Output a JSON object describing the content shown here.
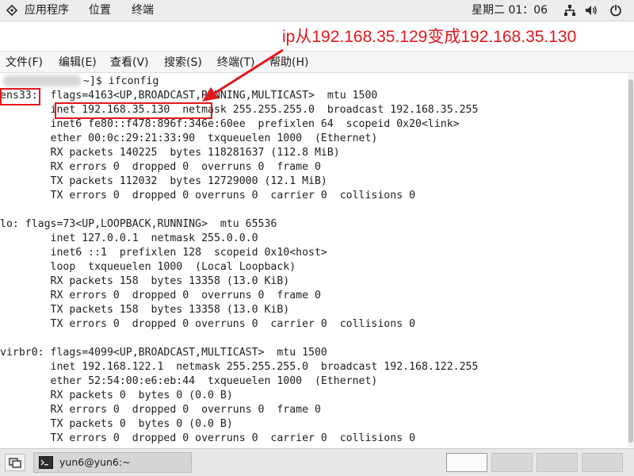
{
  "top_panel": {
    "apps_label": "应用程序",
    "places_label": "位置",
    "terminal_label": "终端",
    "clock": "星期二 01：06",
    "icons": [
      "applications-icon",
      "network-icon",
      "volume-icon",
      "power-icon"
    ]
  },
  "menubar": {
    "file": "文件(F)",
    "edit": "编辑(E)",
    "view": "查看(V)",
    "search": "搜索(S)",
    "terminal": "终端(T)",
    "help": "帮助(H)"
  },
  "annotation": {
    "text": "ip从192.168.35.129变成192.168.35.130",
    "color": "#e3161c"
  },
  "terminal": {
    "prompt_tail": "~]$ ifconfig",
    "lines": [
      "ens33:  flags=4163<UP,BROADCAST,RUNNING,MULTICAST>  mtu 1500",
      "        inet 192.168.35.130  netmask 255.255.255.0  broadcast 192.168.35.255",
      "        inet6 fe80::f478:896f:346e:60ee  prefixlen 64  scopeid 0x20<link>",
      "        ether 00:0c:29:21:33:90  txqueuelen 1000  (Ethernet)",
      "        RX packets 140225  bytes 118281637 (112.8 MiB)",
      "        RX errors 0  dropped 0  overruns 0  frame 0",
      "        TX packets 112032  bytes 12729000 (12.1 MiB)",
      "        TX errors 0  dropped 0 overruns 0  carrier 0  collisions 0",
      "",
      "lo: flags=73<UP,LOOPBACK,RUNNING>  mtu 65536",
      "        inet 127.0.0.1  netmask 255.0.0.0",
      "        inet6 ::1  prefixlen 128  scopeid 0x10<host>",
      "        loop  txqueuelen 1000  (Local Loopback)",
      "        RX packets 158  bytes 13358 (13.0 KiB)",
      "        RX errors 0  dropped 0  overruns 0  frame 0",
      "        TX packets 158  bytes 13358 (13.0 KiB)",
      "        TX errors 0  dropped 0 overruns 0  carrier 0  collisions 0",
      "",
      "virbr0: flags=4099<UP,BROADCAST,MULTICAST>  mtu 1500",
      "        inet 192.168.122.1  netmask 255.255.255.0  broadcast 192.168.122.255",
      "        ether 52:54:00:e6:eb:44  txqueuelen 1000  (Ethernet)",
      "        RX packets 0  bytes 0 (0.0 B)",
      "        RX errors 0  dropped 0  overruns 0  frame 0",
      "        TX packets 0  bytes 0 (0.0 B)",
      "        TX errors 0  dropped 0 overruns 0  carrier 0  collisions 0"
    ]
  },
  "taskbar": {
    "task_label": "yun6@yun6:~",
    "workspace_count": 4
  }
}
